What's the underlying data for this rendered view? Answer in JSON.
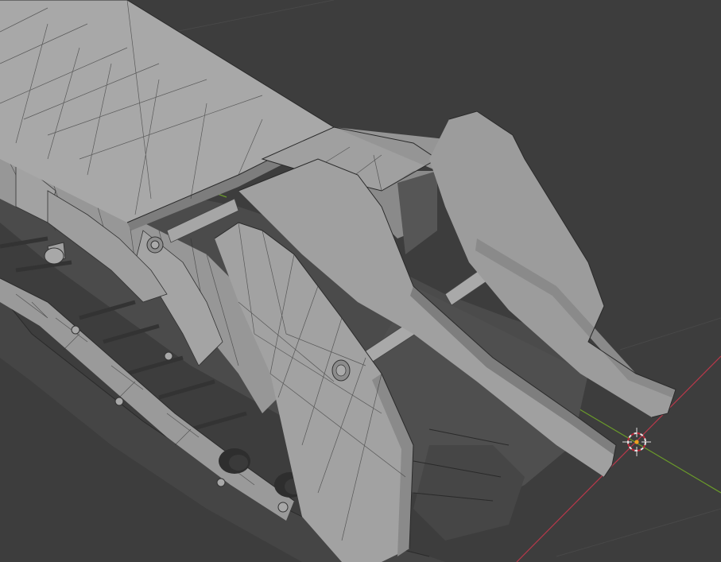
{
  "viewport": {
    "mode": "3d-viewport-solid-wireframe",
    "background_color": "#3d3d3d",
    "grid_color": "#484848",
    "x_axis_color": "#b8384a",
    "y_axis_color": "#6a9a2a",
    "object_color": "#9a9a9a",
    "object_shadow_color": "#4a4a4a",
    "wire_color": "#2f2f2f",
    "cursor_icon": "3d-cursor-icon",
    "cursor_colors": {
      "ring_a": "#e6e6e6",
      "ring_b": "#c0283a",
      "center": "#f0a020"
    }
  }
}
